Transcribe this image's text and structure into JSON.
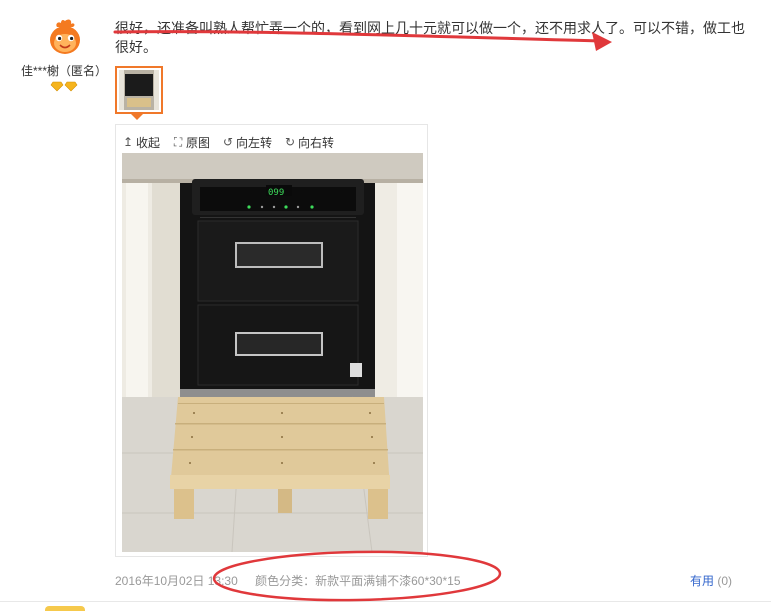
{
  "review": {
    "user": {
      "name": "佳***榭（匿名）"
    },
    "text": "很好，还准备叫熟人帮忙弄一个的，看到网上几十元就可以做一个，还不用求人了。可以不错，做工也很好。",
    "toolbar": {
      "collapse": "收起",
      "original": "原图",
      "rotate_left": "向左转",
      "rotate_right": "向右转"
    },
    "photo": {
      "display_reading": "099"
    },
    "date": "2016年10月02日 13:30",
    "sku": "颜色分类：新款平面满铺不漆60*30*15",
    "useful_label": "有用",
    "useful_count": "(0)"
  },
  "colors": {
    "highlight_border": "#f0782a",
    "link_blue": "#3366cc",
    "annotation_red": "#e0383b"
  }
}
